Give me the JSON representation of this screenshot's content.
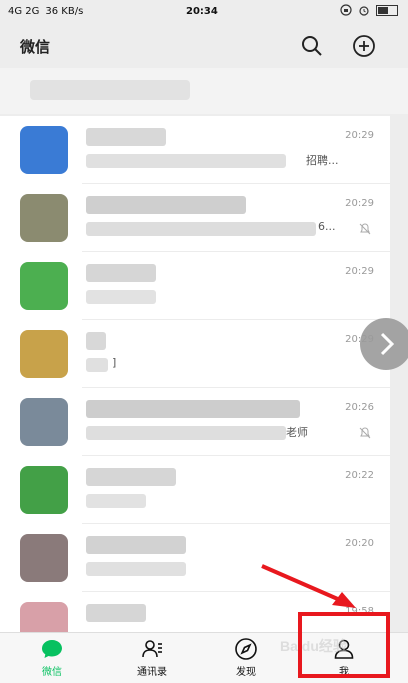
{
  "status_bar": {
    "signal": "4G 2G",
    "speed": "36 KB/s",
    "time": "20:34"
  },
  "header": {
    "title": "微信",
    "search_icon": "search-icon",
    "add_icon": "plus-circle-icon"
  },
  "chats": [
    {
      "time": "20:29",
      "preview_tail": "招聘...",
      "muted": false,
      "avatar_color": "#3a7bd5"
    },
    {
      "time": "20:29",
      "preview_tail": "6...",
      "muted": true,
      "avatar_color": "#8b8b70"
    },
    {
      "time": "20:29",
      "preview_tail": "",
      "muted": false,
      "avatar_color": "#4caf50"
    },
    {
      "time": "20:29",
      "preview_tail": "]",
      "muted": false,
      "avatar_color": "#c8a24a"
    },
    {
      "time": "20:26",
      "preview_tail": "老师",
      "muted": true,
      "avatar_color": "#7a8a9a"
    },
    {
      "time": "20:22",
      "preview_tail": "",
      "muted": false,
      "avatar_color": "#43a047"
    },
    {
      "time": "20:20",
      "preview_tail": "",
      "muted": false,
      "avatar_color": "#8a7a7a"
    },
    {
      "time": "19:58",
      "preview_tail": "",
      "muted": false,
      "avatar_color": "#d8a0a8"
    }
  ],
  "tabs": [
    {
      "label": "微信",
      "icon": "chat-bubble-icon",
      "active": true
    },
    {
      "label": "通讯录",
      "icon": "contacts-icon",
      "active": false
    },
    {
      "label": "发现",
      "icon": "compass-icon",
      "active": false
    },
    {
      "label": "我",
      "icon": "person-icon",
      "active": false
    }
  ],
  "watermark": "Baidu经验",
  "colors": {
    "accent": "#07c160",
    "highlight": "#e8181e"
  }
}
